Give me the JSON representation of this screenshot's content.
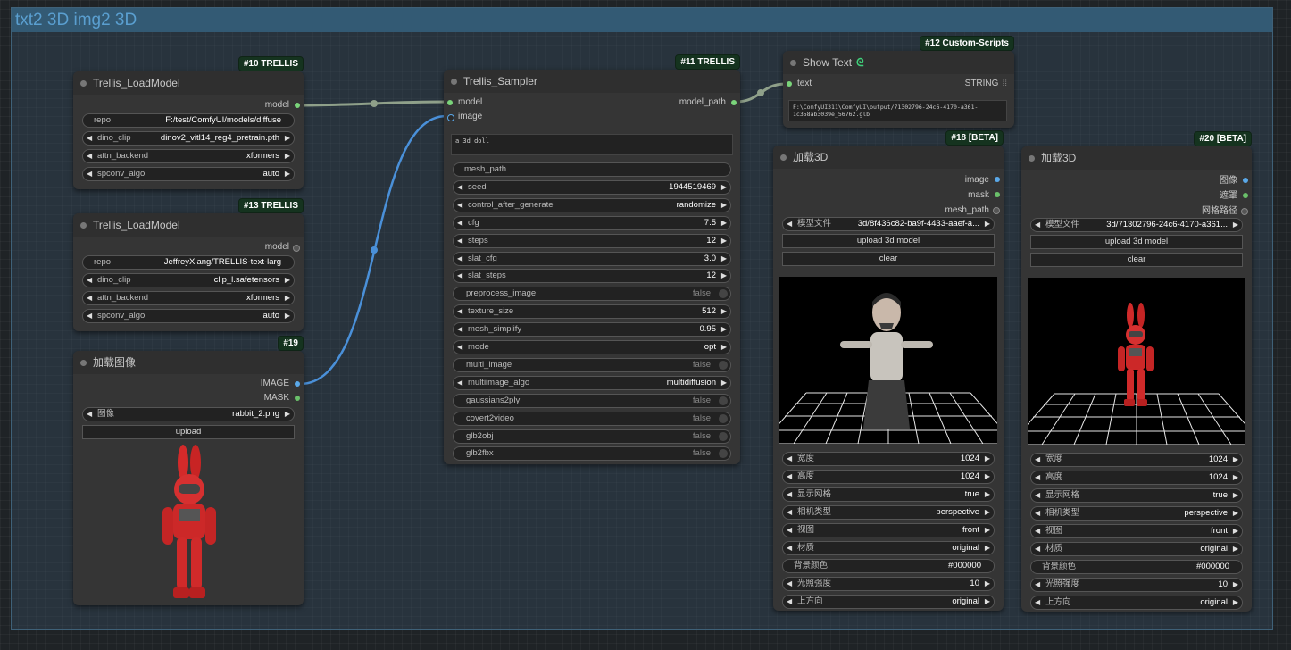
{
  "group": {
    "title": "txt2 3D img2 3D"
  },
  "colors": {
    "model_link": "#8fa08a",
    "image_link": "#4a90d9",
    "model_socket": "#7ad47a",
    "image_socket": "#5aa8e8",
    "mask_socket": "#6ac06a"
  },
  "node10": {
    "badge": "#10 TRELLIS",
    "title": "Trellis_LoadModel",
    "output": "model",
    "repo_label": "repo",
    "repo_value": "F:/test/ComfyUI/models/diffuse",
    "dino_label": "dino_clip",
    "dino_value": "dinov2_vitl14_reg4_pretrain.pth",
    "attn_label": "attn_backend",
    "attn_value": "xformers",
    "spconv_label": "spconv_algo",
    "spconv_value": "auto"
  },
  "node13": {
    "badge": "#13 TRELLIS",
    "title": "Trellis_LoadModel",
    "output": "model",
    "repo_label": "repo",
    "repo_value": "JeffreyXiang/TRELLIS-text-larg",
    "dino_label": "dino_clip",
    "dino_value": "clip_l.safetensors",
    "attn_label": "attn_backend",
    "attn_value": "xformers",
    "spconv_label": "spconv_algo",
    "spconv_value": "auto"
  },
  "node19": {
    "badge": "#19",
    "title": "加载图像",
    "out_image": "IMAGE",
    "out_mask": "MASK",
    "image_label": "图像",
    "image_value": "rabbit_2.png",
    "upload": "upload"
  },
  "node11": {
    "badge": "#11 TRELLIS",
    "title": "Trellis_Sampler",
    "in_model": "model",
    "in_image": "image",
    "output": "model_path",
    "prompt": "a 3d doll",
    "widgets": [
      {
        "label": "mesh_path",
        "value": "",
        "kind": "text"
      },
      {
        "label": "seed",
        "value": "1944519469",
        "kind": "arrows"
      },
      {
        "label": "control_after_generate",
        "value": "randomize",
        "kind": "arrows"
      },
      {
        "label": "cfg",
        "value": "7.5",
        "kind": "arrows"
      },
      {
        "label": "steps",
        "value": "12",
        "kind": "arrows"
      },
      {
        "label": "slat_cfg",
        "value": "3.0",
        "kind": "arrows"
      },
      {
        "label": "slat_steps",
        "value": "12",
        "kind": "arrows"
      },
      {
        "label": "preprocess_image",
        "value": "false",
        "kind": "toggle"
      },
      {
        "label": "texture_size",
        "value": "512",
        "kind": "arrows"
      },
      {
        "label": "mesh_simplify",
        "value": "0.95",
        "kind": "arrows"
      },
      {
        "label": "mode",
        "value": "opt",
        "kind": "arrows"
      },
      {
        "label": "multi_image",
        "value": "false",
        "kind": "toggle"
      },
      {
        "label": "multiimage_algo",
        "value": "multidiffusion",
        "kind": "arrows"
      },
      {
        "label": "gaussians2ply",
        "value": "false",
        "kind": "toggle"
      },
      {
        "label": "covert2video",
        "value": "false",
        "kind": "toggle"
      },
      {
        "label": "glb2obj",
        "value": "false",
        "kind": "toggle"
      },
      {
        "label": "glb2fbx",
        "value": "false",
        "kind": "toggle"
      }
    ]
  },
  "node12": {
    "badge": "#12 Custom-Scripts",
    "title": "Show Text",
    "in_text": "text",
    "type_label": "STRING",
    "text": "F:\\ComfyUI311\\ComfyUI\\output/71302796-24c6-4170-a361-1c358ab3039e_56762.glb"
  },
  "node18": {
    "badge": "#18 [BETA]",
    "title": "加载3D",
    "out_image": "image",
    "out_mask": "mask",
    "out_mesh": "mesh_path",
    "model_label": "模型文件",
    "model_value": "3d/8f436c82-ba9f-4433-aaef-a...",
    "upload": "upload 3d model",
    "clear": "clear",
    "widgets": [
      {
        "label": "宽度",
        "value": "1024",
        "kind": "arrows"
      },
      {
        "label": "高度",
        "value": "1024",
        "kind": "arrows"
      },
      {
        "label": "显示网格",
        "value": "true",
        "kind": "arrows"
      },
      {
        "label": "相机类型",
        "value": "perspective",
        "kind": "arrows"
      },
      {
        "label": "视图",
        "value": "front",
        "kind": "arrows"
      },
      {
        "label": "材质",
        "value": "original",
        "kind": "arrows"
      },
      {
        "label": "背景颜色",
        "value": "#000000",
        "kind": "text"
      },
      {
        "label": "光照强度",
        "value": "10",
        "kind": "arrows"
      },
      {
        "label": "上方向",
        "value": "original",
        "kind": "arrows"
      }
    ]
  },
  "node20": {
    "badge": "#20 [BETA]",
    "title": "加载3D",
    "out_image": "图像",
    "out_mask": "遮罩",
    "out_mesh": "网格路径",
    "model_label": "模型文件",
    "model_value": "3d/71302796-24c6-4170-a361...",
    "upload": "upload 3d model",
    "clear": "clear",
    "widgets": [
      {
        "label": "宽度",
        "value": "1024",
        "kind": "arrows"
      },
      {
        "label": "高度",
        "value": "1024",
        "kind": "arrows"
      },
      {
        "label": "显示网格",
        "value": "true",
        "kind": "arrows"
      },
      {
        "label": "相机类型",
        "value": "perspective",
        "kind": "arrows"
      },
      {
        "label": "视图",
        "value": "front",
        "kind": "arrows"
      },
      {
        "label": "材质",
        "value": "original",
        "kind": "arrows"
      },
      {
        "label": "背景颜色",
        "value": "#000000",
        "kind": "text"
      },
      {
        "label": "光照强度",
        "value": "10",
        "kind": "arrows"
      },
      {
        "label": "上方向",
        "value": "original",
        "kind": "arrows"
      }
    ]
  }
}
